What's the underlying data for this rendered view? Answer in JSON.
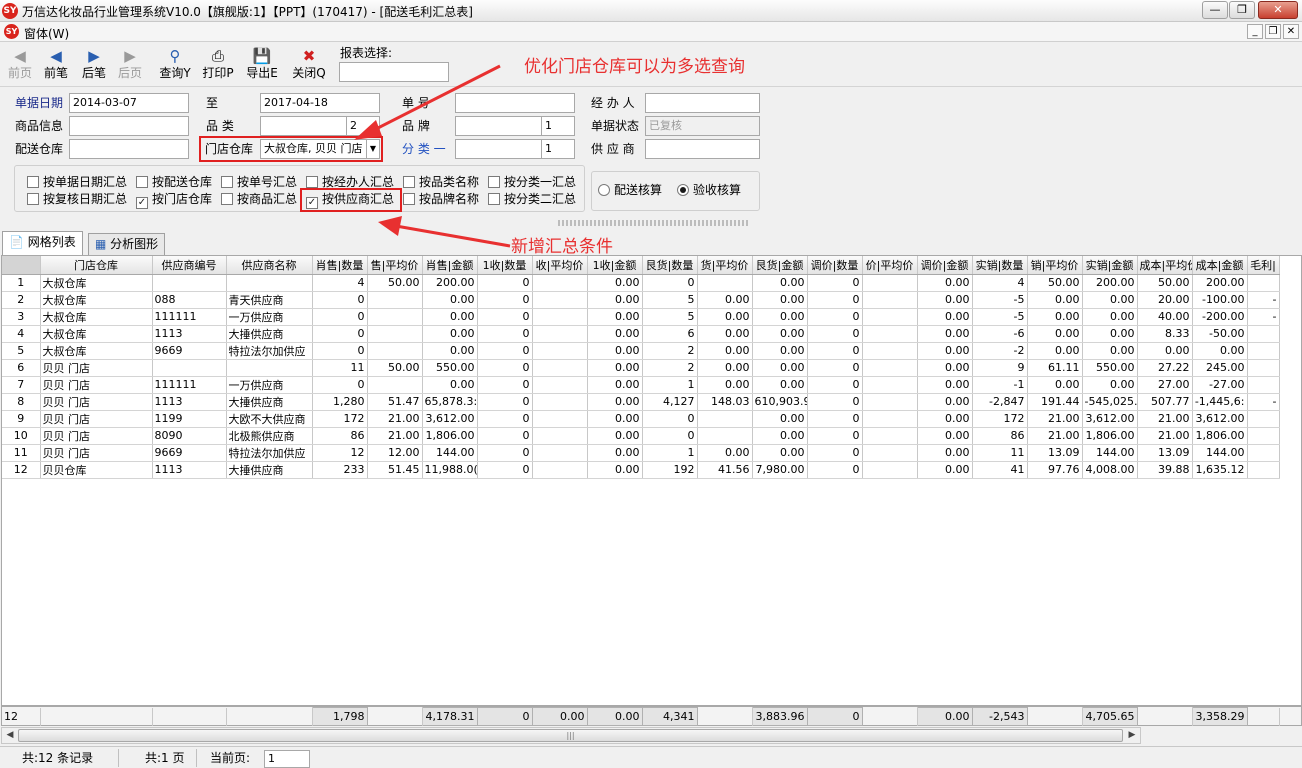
{
  "titlebar": {
    "title": "万信达化妆品行业管理系统V10.0【旗舰版:1】【PPT】(170417) - [配送毛利汇总表]"
  },
  "menubar": {
    "menu_label": "窗体(W)"
  },
  "toolbar": {
    "buttons": [
      {
        "label": "前页",
        "icon": "first-page-icon",
        "enabled": false
      },
      {
        "label": "前笔",
        "icon": "prev-icon",
        "enabled": true
      },
      {
        "label": "后笔",
        "icon": "next-icon",
        "enabled": true
      },
      {
        "label": "后页",
        "icon": "last-page-icon",
        "enabled": false
      },
      {
        "label": "查询Y",
        "icon": "query-icon",
        "enabled": true
      },
      {
        "label": "打印P",
        "icon": "print-icon",
        "enabled": true
      },
      {
        "label": "导出E",
        "icon": "export-icon",
        "enabled": true
      },
      {
        "label": "关闭Q",
        "icon": "close-icon",
        "enabled": true
      }
    ],
    "report_select_label": "报表选择:",
    "report_select_value": ""
  },
  "filters": {
    "date_label": "单据日期",
    "date_from": "2014-03-07",
    "to_label": "至",
    "date_to": "2017-04-18",
    "doc_no_label": "单    号",
    "doc_no_value": "",
    "handler_label": "经 办 人",
    "handler_value": "",
    "product_label": "商品信息",
    "product_value": "",
    "category_label": "品    类",
    "category_value": "",
    "category_level": "2",
    "brand_label": "品    牌",
    "brand_value": "",
    "brand_level": "1",
    "status_label": "单据状态",
    "status_value": "已复核",
    "dist_wh_label": "配送仓库",
    "dist_wh_value": "",
    "store_wh_label": "门店仓库",
    "store_wh_value": "大叔仓库, 贝贝 门店",
    "class1_label": "分 类 一",
    "class1_value": "",
    "class1_level": "1",
    "supplier_label": "供 应 商",
    "supplier_value": ""
  },
  "summary_options": [
    {
      "label": "按单据日期汇总",
      "checked": false
    },
    {
      "label": "按配送仓库",
      "checked": false
    },
    {
      "label": "按单号汇总",
      "checked": false
    },
    {
      "label": "按经办人汇总",
      "checked": false
    },
    {
      "label": "按品类名称",
      "checked": false
    },
    {
      "label": "按分类一汇总",
      "checked": false
    },
    {
      "label": "按复核日期汇总",
      "checked": false
    },
    {
      "label": "按门店仓库",
      "checked": true
    },
    {
      "label": "按商品汇总",
      "checked": false
    },
    {
      "label": "按供应商汇总",
      "checked": true
    },
    {
      "label": "按品牌名称",
      "checked": false
    },
    {
      "label": "按分类二汇总",
      "checked": false
    }
  ],
  "calc_options": [
    {
      "label": "配送核算",
      "selected": false
    },
    {
      "label": "验收核算",
      "selected": true
    }
  ],
  "annotations": {
    "top": "优化门店仓库可以为多选查询",
    "bottom": "新增汇总条件"
  },
  "tabs": [
    {
      "label": "网格列表",
      "icon": "document-icon",
      "active": true
    },
    {
      "label": "分析图形",
      "icon": "chart-icon",
      "active": false
    }
  ],
  "grid": {
    "columns": [
      "",
      "门店仓库",
      "供应商编号",
      "供应商名称",
      "销售|数量",
      "销售|平均价",
      "销售|金额",
      "退收|数量",
      "退收|平均价",
      "退收|金额",
      "退货|数量",
      "退货|平均价",
      "退货|金额",
      "调价|数量",
      "调价|平均价",
      "调价|金额",
      "实销|数量",
      "实销|平均价",
      "实销|金额",
      "成本|平均价",
      "成本|金额",
      "毛利|"
    ],
    "header_display": [
      "",
      "门店仓库",
      "供应商编号",
      "供应商名称",
      "肖售|数量",
      "售|平均价",
      "肖售|金额",
      "1收|数量",
      "收|平均价",
      "1收|金额",
      "艮货|数量",
      "货|平均价",
      "艮货|金额",
      "调价|数量",
      "价|平均价",
      "调价|金额",
      "实销|数量",
      "销|平均价",
      "实销|金额",
      "成本|平均价",
      "成本|金额",
      "毛利|"
    ],
    "rows": [
      [
        "1",
        "大叔仓库",
        "",
        "",
        "4",
        "50.00",
        "200.00",
        "0",
        "",
        "0.00",
        "0",
        "",
        "0.00",
        "0",
        "",
        "0.00",
        "4",
        "50.00",
        "200.00",
        "50.00",
        "200.00",
        ""
      ],
      [
        "2",
        "大叔仓库",
        "088",
        "青天供应商",
        "0",
        "",
        "0.00",
        "0",
        "",
        "0.00",
        "5",
        "0.00",
        "0.00",
        "0",
        "",
        "0.00",
        "-5",
        "0.00",
        "0.00",
        "20.00",
        "-100.00",
        "-"
      ],
      [
        "3",
        "大叔仓库",
        "111111",
        "一万供应商",
        "0",
        "",
        "0.00",
        "0",
        "",
        "0.00",
        "5",
        "0.00",
        "0.00",
        "0",
        "",
        "0.00",
        "-5",
        "0.00",
        "0.00",
        "40.00",
        "-200.00",
        "-"
      ],
      [
        "4",
        "大叔仓库",
        "1113",
        "大捶供应商",
        "0",
        "",
        "0.00",
        "0",
        "",
        "0.00",
        "6",
        "0.00",
        "0.00",
        "0",
        "",
        "0.00",
        "-6",
        "0.00",
        "0.00",
        "8.33",
        "-50.00",
        ""
      ],
      [
        "5",
        "大叔仓库",
        "9669",
        "特拉法尔加供应",
        "0",
        "",
        "0.00",
        "0",
        "",
        "0.00",
        "2",
        "0.00",
        "0.00",
        "0",
        "",
        "0.00",
        "-2",
        "0.00",
        "0.00",
        "0.00",
        "0.00",
        ""
      ],
      [
        "6",
        "贝贝 门店",
        "",
        "",
        "11",
        "50.00",
        "550.00",
        "0",
        "",
        "0.00",
        "2",
        "0.00",
        "0.00",
        "0",
        "",
        "0.00",
        "9",
        "61.11",
        "550.00",
        "27.22",
        "245.00",
        ""
      ],
      [
        "7",
        "贝贝 门店",
        "111111",
        "一万供应商",
        "0",
        "",
        "0.00",
        "0",
        "",
        "0.00",
        "1",
        "0.00",
        "0.00",
        "0",
        "",
        "0.00",
        "-1",
        "0.00",
        "0.00",
        "27.00",
        "-27.00",
        ""
      ],
      [
        "8",
        "贝贝 门店",
        "1113",
        "大捶供应商",
        "1,280",
        "51.47",
        "65,878.3:",
        "0",
        "",
        "0.00",
        "4,127",
        "148.03",
        "610,903.9",
        "0",
        "",
        "0.00",
        "-2,847",
        "191.44",
        "-545,025.",
        "507.77",
        "-1,445,6:",
        "-"
      ],
      [
        "9",
        "贝贝 门店",
        "1199",
        "大欧不大供应商",
        "172",
        "21.00",
        "3,612.00",
        "0",
        "",
        "0.00",
        "0",
        "",
        "0.00",
        "0",
        "",
        "0.00",
        "172",
        "21.00",
        "3,612.00",
        "21.00",
        "3,612.00",
        ""
      ],
      [
        "10",
        "贝贝 门店",
        "8090",
        "北极熊供应商",
        "86",
        "21.00",
        "1,806.00",
        "0",
        "",
        "0.00",
        "0",
        "",
        "0.00",
        "0",
        "",
        "0.00",
        "86",
        "21.00",
        "1,806.00",
        "21.00",
        "1,806.00",
        ""
      ],
      [
        "11",
        "贝贝 门店",
        "9669",
        "特拉法尔加供应",
        "12",
        "12.00",
        "144.00",
        "0",
        "",
        "0.00",
        "1",
        "0.00",
        "0.00",
        "0",
        "",
        "0.00",
        "11",
        "13.09",
        "144.00",
        "13.09",
        "144.00",
        ""
      ],
      [
        "12",
        "贝贝仓库",
        "1113",
        "大捶供应商",
        "233",
        "51.45",
        "11,988.0(",
        "0",
        "",
        "0.00",
        "192",
        "41.56",
        "7,980.00",
        "0",
        "",
        "0.00",
        "41",
        "97.76",
        "4,008.00",
        "39.88",
        "1,635.12",
        ""
      ]
    ]
  },
  "footer": {
    "count": "12",
    "values": [
      "",
      "",
      "",
      "1,798",
      "",
      "4,178.31",
      "0",
      "0.00",
      "0.00",
      "4,341",
      "",
      "3,883.96",
      "0",
      "",
      "0.00",
      "-2,543",
      "",
      "4,705.65",
      "",
      "3,358.29",
      ""
    ]
  },
  "statusbar": {
    "records": "共:12 条记录",
    "pages": "共:1 页",
    "current_label": "当前页:",
    "current_value": "1"
  }
}
